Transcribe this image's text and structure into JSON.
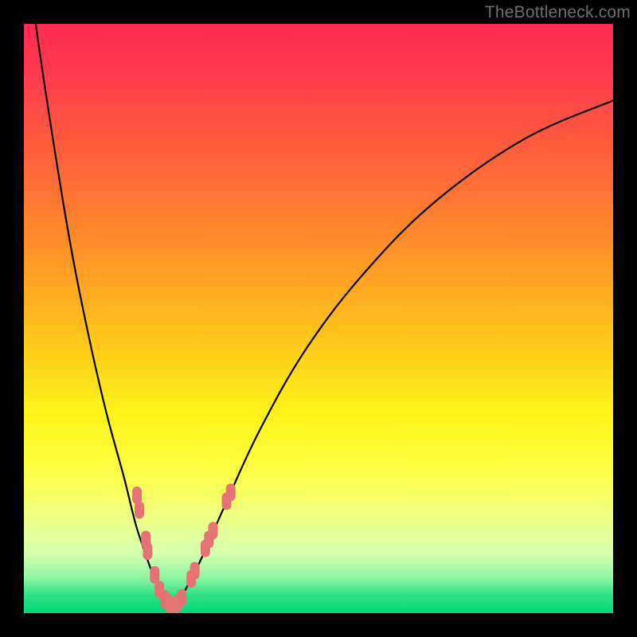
{
  "watermark": "TheBottleneck.com",
  "colors": {
    "background": "#000000",
    "curve": "#000000",
    "bead": "#e57373",
    "gradient_top": "#ff2a52",
    "gradient_mid": "#ffe11a",
    "gradient_bottom": "#00d977"
  },
  "chart_data": {
    "type": "line",
    "title": "",
    "xlabel": "",
    "ylabel": "",
    "xlim": [
      0,
      100
    ],
    "ylim": [
      0,
      100
    ],
    "grid": false,
    "legend": false,
    "note": "No axis labels or tick marks are rendered in the image; values are estimated from pixel positions over a 0–100 normalized range matching the plot area.",
    "series": [
      {
        "name": "curve",
        "x": [
          0,
          2,
          5,
          8,
          11,
          14,
          17,
          19,
          21,
          22.5,
          24,
          25,
          26,
          27,
          30,
          34,
          40,
          48,
          58,
          70,
          85,
          100
        ],
        "y": [
          116,
          100,
          80,
          62,
          47,
          34,
          23,
          15,
          9,
          5,
          2.2,
          1.2,
          1.8,
          3.2,
          9,
          18,
          31,
          45,
          58,
          70,
          80.5,
          87
        ]
      }
    ],
    "markers": [
      {
        "name": "beads",
        "shape": "rounded-rect",
        "color": "#e57373",
        "points": [
          {
            "x": 19.2,
            "y": 20.0
          },
          {
            "x": 19.6,
            "y": 17.5
          },
          {
            "x": 20.7,
            "y": 12.5
          },
          {
            "x": 21.0,
            "y": 10.5
          },
          {
            "x": 22.2,
            "y": 6.5
          },
          {
            "x": 23.0,
            "y": 4.0
          },
          {
            "x": 23.9,
            "y": 2.4
          },
          {
            "x": 24.6,
            "y": 1.6
          },
          {
            "x": 25.3,
            "y": 1.3
          },
          {
            "x": 26.0,
            "y": 1.6
          },
          {
            "x": 26.8,
            "y": 2.6
          },
          {
            "x": 28.4,
            "y": 5.8
          },
          {
            "x": 29.0,
            "y": 7.2
          },
          {
            "x": 30.8,
            "y": 11.0
          },
          {
            "x": 31.4,
            "y": 12.5
          },
          {
            "x": 32.1,
            "y": 14.0
          },
          {
            "x": 34.4,
            "y": 19.0
          },
          {
            "x": 35.1,
            "y": 20.5
          }
        ]
      }
    ]
  }
}
